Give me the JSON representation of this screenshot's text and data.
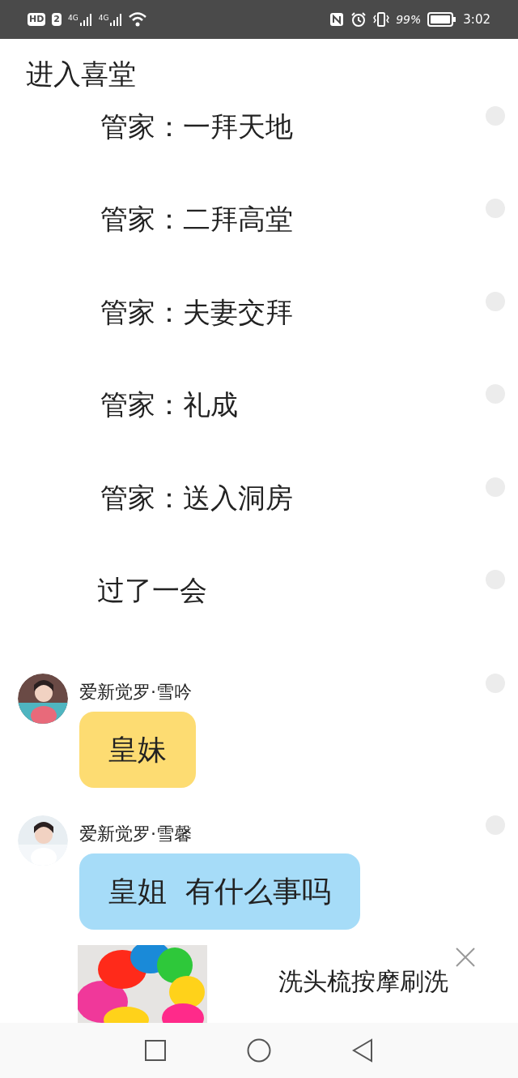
{
  "status_bar": {
    "hd": "HD",
    "sim": "2",
    "net1": "4G",
    "net2": "4G",
    "battery": "99%",
    "time": "3:02"
  },
  "title": "进入喜堂",
  "lines": [
    {
      "kind": "narration",
      "text": "管家：一拜天地"
    },
    {
      "kind": "narration",
      "text": "管家：二拜高堂"
    },
    {
      "kind": "narration",
      "text": "管家：夫妻交拜"
    },
    {
      "kind": "narration",
      "text": "管家：礼成"
    },
    {
      "kind": "narration",
      "text": "管家：送入洞房"
    },
    {
      "kind": "narration",
      "text": "过了一会"
    },
    {
      "kind": "message",
      "name": "爱新觉罗·雪吟",
      "text": "皇妹",
      "color": "#fddc72"
    },
    {
      "kind": "message",
      "name": "爱新觉罗·雪馨",
      "text": "皇姐  有什么事吗",
      "color": "#a6dcf8"
    }
  ],
  "ad": {
    "title": "洗头梳按摩刷洗"
  }
}
